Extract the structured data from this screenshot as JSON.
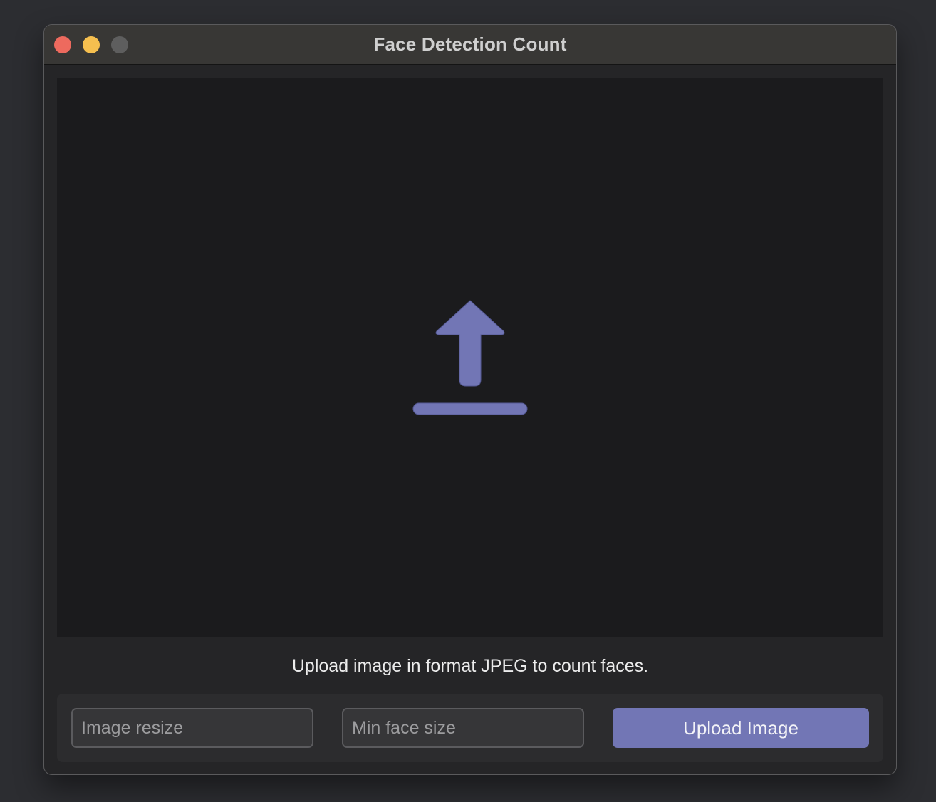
{
  "window": {
    "title": "Face Detection Count"
  },
  "drop_area": {
    "icon": "upload-icon",
    "icon_color": "#7276b5"
  },
  "caption": "Upload image in format JPEG to count faces.",
  "controls": {
    "image_resize_placeholder": "Image resize",
    "min_face_size_placeholder": "Min face size",
    "upload_button_label": "Upload Image"
  },
  "colors": {
    "accent": "#7276b5",
    "close": "#ed6a5e",
    "minimize": "#f5bf4f",
    "zoom_disabled": "#5e5e5e"
  }
}
